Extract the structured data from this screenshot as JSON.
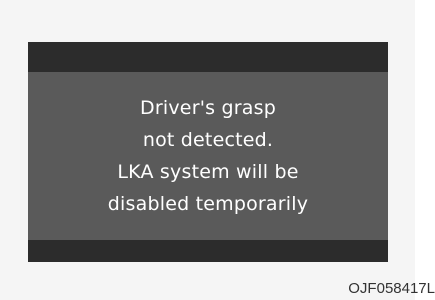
{
  "display": {
    "message_lines": [
      "Driver's grasp",
      "not detected.",
      "LKA system will be",
      "disabled temporarily"
    ]
  },
  "figure_code": "OJF058417L",
  "colors": {
    "screen_background": "#5a5a5a",
    "bar_color": "#2c2c2c",
    "text_color": "#ffffff",
    "frame_background": "#f5f5f5"
  }
}
